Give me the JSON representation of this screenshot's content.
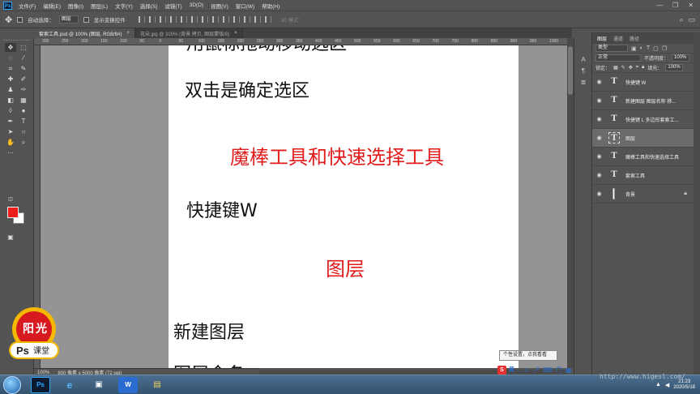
{
  "menubar": {
    "logo": "Ps",
    "items": [
      "文件(F)",
      "编辑(E)",
      "图像(I)",
      "图层(L)",
      "文字(Y)",
      "选择(S)",
      "滤镜(T)",
      "3D(D)",
      "视图(V)",
      "窗口(W)",
      "帮助(H)"
    ],
    "minimize": "—",
    "restore": "❐",
    "close": "✕"
  },
  "options": {
    "auto_select_label": "自动选择：",
    "auto_select_value": "图层",
    "show_transform_label": "显示变换控件",
    "mode3d_label": "3D 模式："
  },
  "tabs": [
    {
      "label": "套索工具.psd @ 100% (图层, RGB/8#)",
      "close": "×"
    },
    {
      "label": "花朵.jpg @ 100% (背景 拷贝, 图层蒙版/8)",
      "close": "×"
    }
  ],
  "ruler": {
    "ticks": [
      "300",
      "250",
      "200",
      "150",
      "100",
      "50",
      "0",
      "50",
      "100",
      "150",
      "200",
      "250",
      "300",
      "350",
      "400",
      "450",
      "500",
      "550",
      "600",
      "650",
      "700",
      "750",
      "800",
      "850",
      "900",
      "950",
      "1000"
    ]
  },
  "document": {
    "line_top": "用鼠标拖动移动选区",
    "line1": "双击是确定选区",
    "line2": "魔棒工具和快速选择工具",
    "line3": "快捷键W",
    "line4": "图层",
    "line5": "新建图层",
    "line_bottom": "图层命名"
  },
  "status": {
    "zoom": "100%",
    "doc_size": "800 像素 x 5000 像素 (72 ppi)"
  },
  "layers_panel": {
    "tabs": [
      "图层",
      "通道",
      "路径"
    ],
    "filter_label": "类型",
    "blend_mode": "正常",
    "opacity_label": "不透明度：",
    "opacity_value": "100%",
    "lock_label": "锁定：",
    "fill_label": "填充：",
    "fill_value": "100%",
    "layers": [
      {
        "type": "T",
        "name": "快捷键 W"
      },
      {
        "type": "T",
        "name": "新建图层 图层名称 移..."
      },
      {
        "type": "T",
        "name": "快捷键 L 多边形套索工..."
      },
      {
        "type": "T",
        "name": "图层"
      },
      {
        "type": "T",
        "name": "魔棒工具和快速选择工具"
      },
      {
        "type": "T",
        "name": "套索工具"
      },
      {
        "type": "bg",
        "name": "背景"
      }
    ]
  },
  "tooltip": "个性设置，点我看看",
  "ime": {
    "logo": "S",
    "lang": "英"
  },
  "taskbar": {
    "apps": [
      "Ps",
      "e",
      "▣",
      "W",
      "▤"
    ],
    "time": "21:23",
    "date": "2020/5/18"
  },
  "watermark": "http://www.higesl.com/",
  "logo": {
    "char1": "阳",
    "char2": "光",
    "brand": "Ps",
    "sub": "课堂"
  },
  "colors": {
    "accent_red": "#e21b1b",
    "fg_color": "#ee1d1d",
    "bg_color": "#ffffff"
  }
}
